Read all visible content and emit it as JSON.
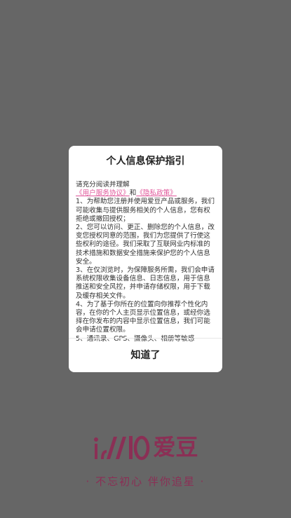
{
  "dialog": {
    "title": "个人信息保护指引",
    "intro": "请充分阅读并理解",
    "link_user_agreement": "《用户服务协议》",
    "and": "和",
    "link_privacy_policy": "《隐私政策》",
    "item1": "1、为帮助您注册并使用爱豆产品或服务，我们可能收集与提供服务相关的个人信息，您有权拒绝或撤回授权；",
    "item2": "2、您可以访问、更正、删除您的个人信息，改变您授权同意的范围，我们为您提供了行使这些权利的途径。我们采取了互联网业内标准的技术措施和数据安全措施来保护您的个人信息安全。",
    "item3": "3、在仅浏览时，为保障服务所需，我们会申请系统权限收集设备信息、日志信息，用于信息推送和安全风控，并申请存储权限，用于下载及缓存相关文件。",
    "item4": "4、为了基于你所在的位置向你推荐个性化内容，在你的个人主页显示位置信息，或经你选择在你发布的内容中显示位置信息，我们可能会申请位置权限。",
    "item5": "5、通讯录、GPS、摄像头、相册等敏感",
    "confirm_label": "知道了"
  },
  "brand": {
    "name": "爱豆",
    "slogan_dot_left": "·",
    "slogan": "不忘初心 伴你追星",
    "slogan_dot_right": "·",
    "color": "#8b2f55"
  }
}
